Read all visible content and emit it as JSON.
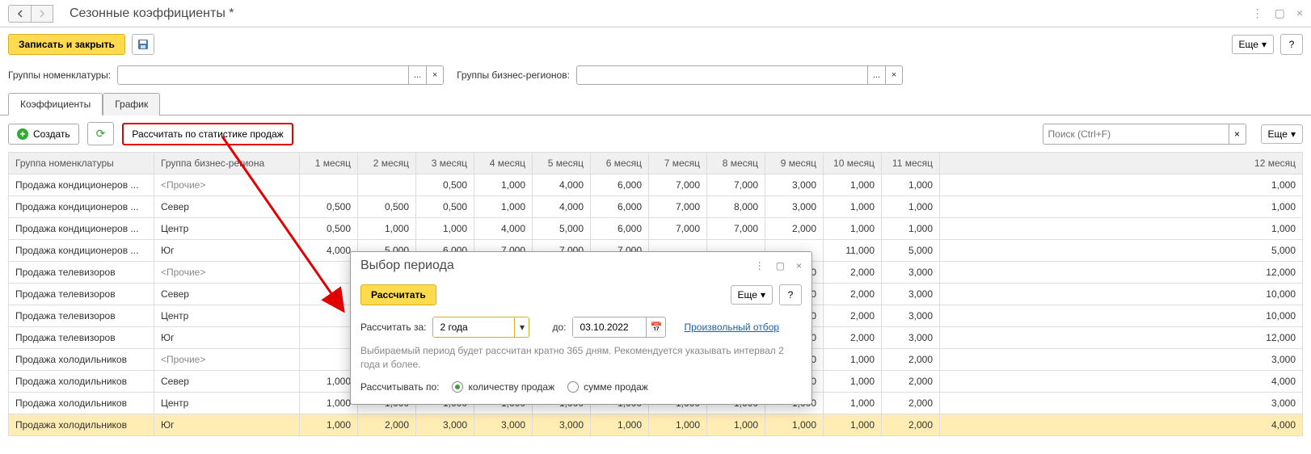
{
  "header": {
    "title": "Сезонные коэффициенты *"
  },
  "toolbar": {
    "save_close": "Записать и закрыть",
    "more": "Еще",
    "help": "?"
  },
  "filters": {
    "nomen_label": "Группы номенклатуры:",
    "nomen_value": "",
    "region_label": "Группы бизнес-регионов:",
    "region_value": "",
    "ellipsis": "...",
    "clear": "×"
  },
  "tabs": {
    "t1": "Коэффициенты",
    "t2": "График"
  },
  "ttoolbar": {
    "create": "Создать",
    "calc": "Рассчитать по статистике продаж",
    "search_ph": "Поиск (Ctrl+F)",
    "more": "Еще"
  },
  "cols": {
    "grp": "Группа номенклатуры",
    "reg": "Группа бизнес-региона",
    "m1": "1 месяц",
    "m2": "2 месяц",
    "m3": "3 месяц",
    "m4": "4 месяц",
    "m5": "5 месяц",
    "m6": "6 месяц",
    "m7": "7 месяц",
    "m8": "8 месяц",
    "m9": "9 месяц",
    "m10": "10 месяц",
    "m11": "11 месяц",
    "m12": "12 месяц"
  },
  "rows": [
    {
      "grp": "Продажа кондиционеров ...",
      "reg": "<Прочие>",
      "dim": true,
      "m": [
        "",
        "",
        "0,500",
        "1,000",
        "4,000",
        "6,000",
        "7,000",
        "7,000",
        "3,000",
        "1,000",
        "1,000",
        "1,000"
      ]
    },
    {
      "grp": "Продажа кондиционеров ...",
      "reg": "Север",
      "m": [
        "0,500",
        "0,500",
        "0,500",
        "1,000",
        "4,000",
        "6,000",
        "7,000",
        "8,000",
        "3,000",
        "1,000",
        "1,000",
        "1,000"
      ]
    },
    {
      "grp": "Продажа кондиционеров ...",
      "reg": "Центр",
      "m": [
        "0,500",
        "1,000",
        "1,000",
        "4,000",
        "5,000",
        "6,000",
        "7,000",
        "7,000",
        "2,000",
        "1,000",
        "1,000",
        "1,000"
      ]
    },
    {
      "grp": "Продажа кондиционеров ...",
      "reg": "Юг",
      "m": [
        "4,000",
        "5,000",
        "6,000",
        "7,000",
        "7,000",
        "7,000",
        "",
        "",
        "",
        "11,000",
        "5,000",
        "5,000"
      ]
    },
    {
      "grp": "Продажа телевизоров",
      "reg": "<Прочие>",
      "dim": true,
      "m": [
        "",
        "",
        "",
        "",
        "",
        "",
        "",
        "",
        "2,000",
        "2,000",
        "3,000",
        "12,000"
      ]
    },
    {
      "grp": "Продажа телевизоров",
      "reg": "Север",
      "m": [
        "",
        "",
        "",
        "",
        "",
        "",
        "",
        "",
        "2,000",
        "2,000",
        "3,000",
        "10,000"
      ]
    },
    {
      "grp": "Продажа телевизоров",
      "reg": "Центр",
      "m": [
        "",
        "",
        "",
        "",
        "",
        "",
        "",
        "",
        "2,000",
        "2,000",
        "3,000",
        "10,000"
      ]
    },
    {
      "grp": "Продажа телевизоров",
      "reg": "Юг",
      "m": [
        "",
        "",
        "",
        "",
        "",
        "",
        "",
        "",
        "2,000",
        "2,000",
        "3,000",
        "12,000"
      ]
    },
    {
      "grp": "Продажа холодильников",
      "reg": "<Прочие>",
      "dim": true,
      "m": [
        "",
        "",
        "",
        "",
        "",
        "",
        "",
        "",
        "1,000",
        "1,000",
        "2,000",
        "3,000"
      ]
    },
    {
      "grp": "Продажа холодильников",
      "reg": "Север",
      "m": [
        "1,000",
        "",
        "",
        "",
        "",
        "",
        "",
        "",
        "1,000",
        "1,000",
        "2,000",
        "4,000"
      ]
    },
    {
      "grp": "Продажа холодильников",
      "reg": "Центр",
      "m": [
        "1,000",
        "1,000",
        "1,000",
        "1,000",
        "1,000",
        "1,000",
        "1,000",
        "1,000",
        "1,000",
        "1,000",
        "2,000",
        "3,000"
      ]
    },
    {
      "grp": "Продажа холодильников",
      "reg": "Юг",
      "sel": true,
      "m": [
        "1,000",
        "2,000",
        "3,000",
        "3,000",
        "3,000",
        "1,000",
        "1,000",
        "1,000",
        "1,000",
        "1,000",
        "2,000",
        "4,000"
      ]
    }
  ],
  "dialog": {
    "title": "Выбор периода",
    "calc": "Рассчитать",
    "more": "Еще",
    "help": "?",
    "period_label": "Рассчитать за:",
    "period_value": "2 года",
    "to_label": "до:",
    "to_value": "03.10.2022",
    "custom_filter": "Произвольный отбор",
    "hint": "Выбираемый период будет рассчитан кратно 365 дням. Рекомендуется указывать интервал 2 года и более.",
    "calc_by_label": "Рассчитывать по:",
    "radio_qty": "количеству продаж",
    "radio_sum": "сумме продаж"
  }
}
